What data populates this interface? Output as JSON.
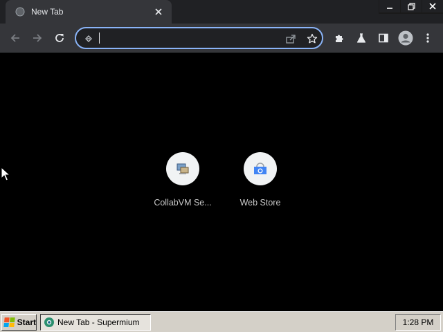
{
  "browser": {
    "tab": {
      "title": "New Tab"
    },
    "window_controls": [
      "minimize",
      "restore",
      "close"
    ],
    "omnibox": {
      "value": "",
      "placeholder": ""
    },
    "toolbar_icons": [
      "back-icon",
      "forward-icon",
      "reload-icon",
      "extensions-icon",
      "labs-icon",
      "side-panel-icon",
      "profile-icon",
      "menu-icon"
    ]
  },
  "new_tab": {
    "shortcuts": [
      {
        "label": "CollabVM Se...",
        "icon": "collabvm-icon"
      },
      {
        "label": "Web Store",
        "icon": "web-store-icon"
      }
    ]
  },
  "taskbar": {
    "start_label": "Start",
    "task_label": "New Tab - Supermium",
    "clock": "1:28 PM"
  },
  "colors": {
    "accent": "#8ab4f8",
    "chrome_bg": "#35363a",
    "tabstrip_bg": "#202124",
    "page_bg": "#000000",
    "taskbar_bg": "#d4d0c8"
  }
}
